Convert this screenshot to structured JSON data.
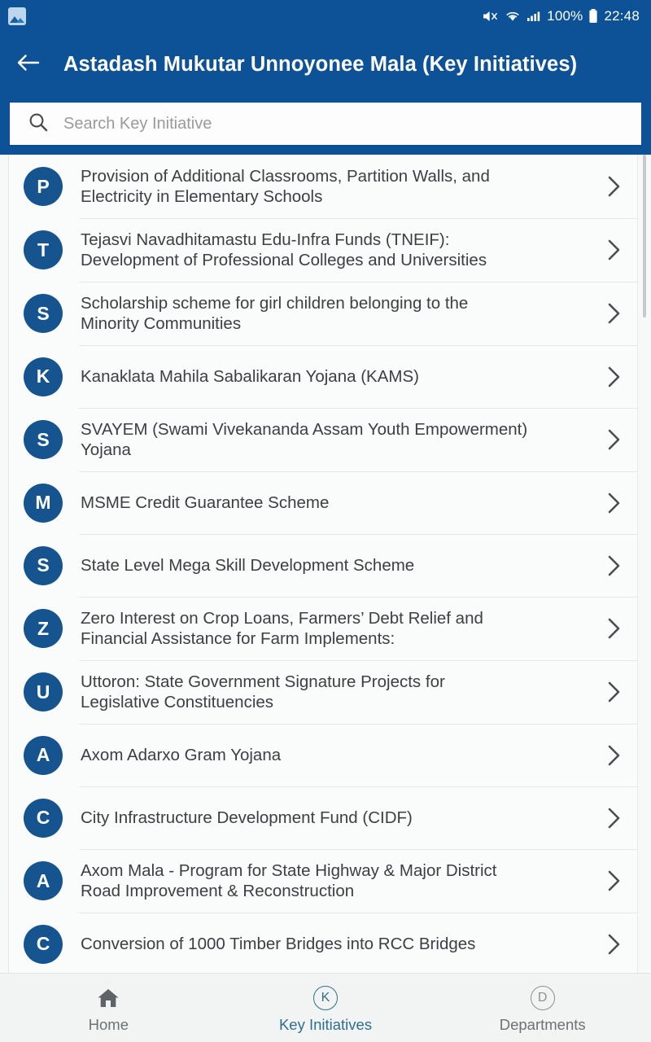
{
  "statusbar": {
    "gallery_icon": "gallery-icon",
    "mute_icon": "volume-mute-icon",
    "wifi_icon": "wifi-icon",
    "signal_icon": "cellular-signal-icon",
    "battery_percent": "100%",
    "battery_icon": "battery-full-icon",
    "time": "22:48"
  },
  "appbar": {
    "back_icon": "back-arrow-icon",
    "title": "Astadash Mukutar Unnoyonee Mala (Key Initiatives)"
  },
  "search": {
    "icon": "search-icon",
    "placeholder": "Search Key Initiative",
    "value": ""
  },
  "colors": {
    "header_blue": "#0d5297",
    "avatar_blue": "#15548f",
    "active_nav": "#2e6e8e",
    "inactive_nav": "#6d7275",
    "list_bg": "#fafbfb",
    "page_bg": "#f7f8f8"
  },
  "list": {
    "chevron_icon": "chevron-right-icon",
    "items": [
      {
        "initial": "P",
        "title": "Provision of Additional Classrooms, Partition Walls, and\nElectricity in Elementary Schools"
      },
      {
        "initial": "T",
        "title": "Tejasvi Navadhitamastu Edu-Infra Funds (TNEIF):\nDevelopment of Professional Colleges and Universities"
      },
      {
        "initial": "S",
        "title": "Scholarship scheme for girl children belonging to the\nMinority Communities"
      },
      {
        "initial": "K",
        "title": "Kanaklata Mahila Sabalikaran Yojana (KAMS)"
      },
      {
        "initial": "S",
        "title": "SVAYEM (Swami Vivekananda Assam Youth Empowerment)\nYojana"
      },
      {
        "initial": "M",
        "title": "MSME Credit Guarantee Scheme"
      },
      {
        "initial": "S",
        "title": "State Level Mega Skill Development Scheme"
      },
      {
        "initial": "Z",
        "title": "Zero Interest on Crop Loans, Farmers’ Debt Relief and\nFinancial Assistance for Farm Implements:"
      },
      {
        "initial": "U",
        "title": "Uttoron: State Government Signature Projects for\nLegislative Constituencies"
      },
      {
        "initial": "A",
        "title": "Axom Adarxo Gram Yojana"
      },
      {
        "initial": "C",
        "title": "City Infrastructure Development Fund (CIDF)"
      },
      {
        "initial": "A",
        "title": "Axom Mala - Program for State Highway & Major District\nRoad Improvement & Reconstruction"
      },
      {
        "initial": "C",
        "title": "Conversion of 1000 Timber Bridges into RCC Bridges"
      }
    ]
  },
  "bottomnav": {
    "items": [
      {
        "label": "Home",
        "icon": "home-icon",
        "active": false
      },
      {
        "label": "Key Initiatives",
        "icon": "key-initiatives-icon",
        "letter": "K",
        "active": true
      },
      {
        "label": "Departments",
        "icon": "departments-icon",
        "letter": "D",
        "active": false
      }
    ]
  }
}
